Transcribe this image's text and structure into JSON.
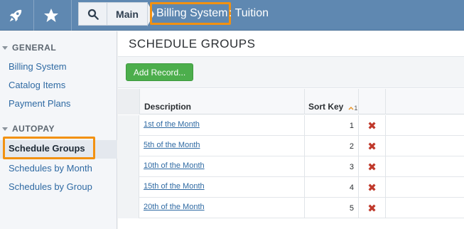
{
  "topbar": {
    "breadcrumb_main": "Main",
    "title_highlight": "Billing System",
    "title_rest": ": Tuition"
  },
  "sidebar": {
    "sections": [
      {
        "label": "GENERAL",
        "items": [
          "Billing System",
          "Catalog Items",
          "Payment Plans"
        ]
      },
      {
        "label": "AUTOPAY",
        "items": [
          "Schedule Groups",
          "Schedules by Month",
          "Schedules by Group"
        ]
      }
    ],
    "active_item": "Schedule Groups"
  },
  "main": {
    "title": "SCHEDULE GROUPS",
    "add_button": "Add Record...",
    "columns": {
      "description": "Description",
      "sort_key": "Sort Key",
      "sort_indicator": "1"
    },
    "rows": [
      {
        "description": "1st of the Month",
        "sort_key": "1"
      },
      {
        "description": "5th of the Month",
        "sort_key": "2"
      },
      {
        "description": "10th of the Month",
        "sort_key": "3"
      },
      {
        "description": "15th of the Month",
        "sort_key": "4"
      },
      {
        "description": "20th of the Month",
        "sort_key": "5"
      }
    ]
  },
  "colors": {
    "topbar": "#5f88b1",
    "highlight": "#f29111",
    "add_button": "#4cae4c",
    "delete": "#c0392b",
    "link": "#2f6aa3"
  },
  "icons": [
    "rocket-icon",
    "star-icon",
    "search-icon",
    "sort-asc-icon",
    "delete-icon"
  ]
}
